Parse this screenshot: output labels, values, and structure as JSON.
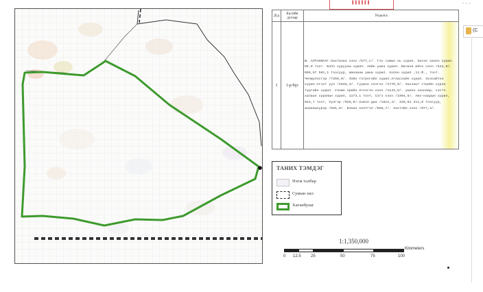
{
  "stamp_text": "▌▌▌▌▌▌",
  "table": {
    "headers": [
      "Д/д",
      "Бүсийн дугаар",
      "Ухаалга"
    ],
    "rows": [
      {
        "no": "1",
        "parcel": "1-р бүс",
        "desc": "Ш. АЛТАНЖААГ.Нахтанаа озоо /577,с/. Гэх сумын нь хурил, Хахзн хаалн хурил. 56.0 тоот. Бэлэ хурууны хурил. лийн ушна хурил. Вачана мёнэ озоо /512,0/. 866,87 561,1 тоосуур, жанааны ушна хурил. Холон хурил ,11.Ф., тоот. Челмулэсгэр /7256,0/. Зэйн тэгрнгийн хурил.Агласхайн хурил. Эхосийтэн хурил.Агээт уул /1646,4/. Гуушэн нээгнэ /1776,9/. Хахзныг стрийн хурэн тургийн хурил. Уэнжн эрийн Агнзгэн озоо /1143,8/. ушэнн хахнаар, хэстэ халаан хурилын хурил, 1173,1 тоот, Сэгэ озоо /1994,6/. Ажэ-наарын хурил, 944,7 тоот, Уулгэр /926,9/.Хэвэл даа /1611,4/. 248,01 211,0 тоосуур, анааныхурэр /581,9/. Бэнан нэлтгэл /856,7/. Хахтэйн озоо /877,4/."
      }
    ]
  },
  "legend": {
    "title": "ТАНИХ ТЭМДЭГ",
    "items": [
      {
        "label": "Нэгж талбар",
        "swatch": "soum"
      },
      {
        "label": "Сумын хил",
        "swatch": "border"
      },
      {
        "label": "Хатанбулаг",
        "swatch": "area"
      }
    ]
  },
  "scale": {
    "ratio": "1:1,350,000",
    "ticks": [
      "0",
      "12.5",
      "25",
      "50",
      "75",
      "100"
    ],
    "unit": "Kilometers"
  },
  "side_tab": {
    "label": "(С"
  },
  "colors": {
    "area_outline": "#3d9a2d",
    "soum_border": "#333333",
    "stamp": "#d8333b",
    "highlight": "#f6f2a0"
  }
}
